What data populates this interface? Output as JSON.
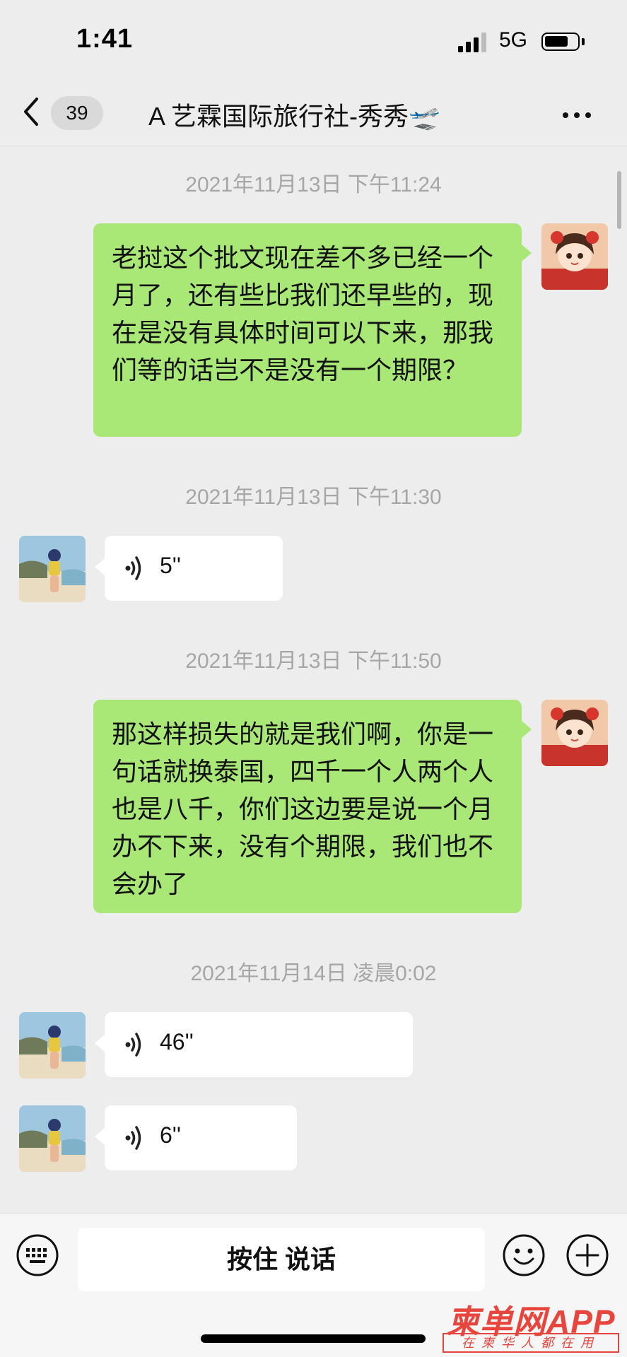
{
  "status_bar": {
    "time": "1:41",
    "network": "5G",
    "battery_level": 0.75
  },
  "header": {
    "unread_count": "39",
    "title": "A 艺霖国际旅行社-秀秀🛫"
  },
  "messages": [
    {
      "type": "timestamp",
      "text": "2021年11月13日 下午11:24"
    },
    {
      "type": "text",
      "sender": "me",
      "text": "老挝这个批文现在差不多已经一个月了，还有些比我们还早些的，现在是没有具体时间可以下来，那我们等的话岂不是没有一个期限？"
    },
    {
      "type": "timestamp",
      "text": "2021年11月13日 下午11:30"
    },
    {
      "type": "voice",
      "sender": "other",
      "duration": "5''"
    },
    {
      "type": "timestamp",
      "text": "2021年11月13日 下午11:50"
    },
    {
      "type": "text",
      "sender": "me",
      "text": "那这样损失的就是我们啊，你是一句话就换泰国，四千一个人两个人也是八千，你们这边要是说一个月办不下来，没有个期限，我们也不会办了"
    },
    {
      "type": "timestamp",
      "text": "2021年11月14日 凌晨0:02"
    },
    {
      "type": "voice",
      "sender": "other",
      "duration": "46''"
    },
    {
      "type": "voice",
      "sender": "other",
      "duration": "6''"
    }
  ],
  "input_bar": {
    "hold_to_talk_label": "按住 说话"
  },
  "watermark": {
    "title": "柬单网APP",
    "subtitle": "在柬华人都在用"
  },
  "colors": {
    "outgoing_bubble": "#a9e876",
    "incoming_bubble": "#ffffff",
    "background": "#ededed",
    "timestamp": "#a6a6a6",
    "watermark": "#e8453c"
  },
  "icons": [
    "back-chevron-icon",
    "more-dots-icon",
    "voice-wave-icon",
    "keyboard-icon",
    "emoji-icon",
    "plus-icon",
    "signal-icon",
    "battery-icon"
  ]
}
